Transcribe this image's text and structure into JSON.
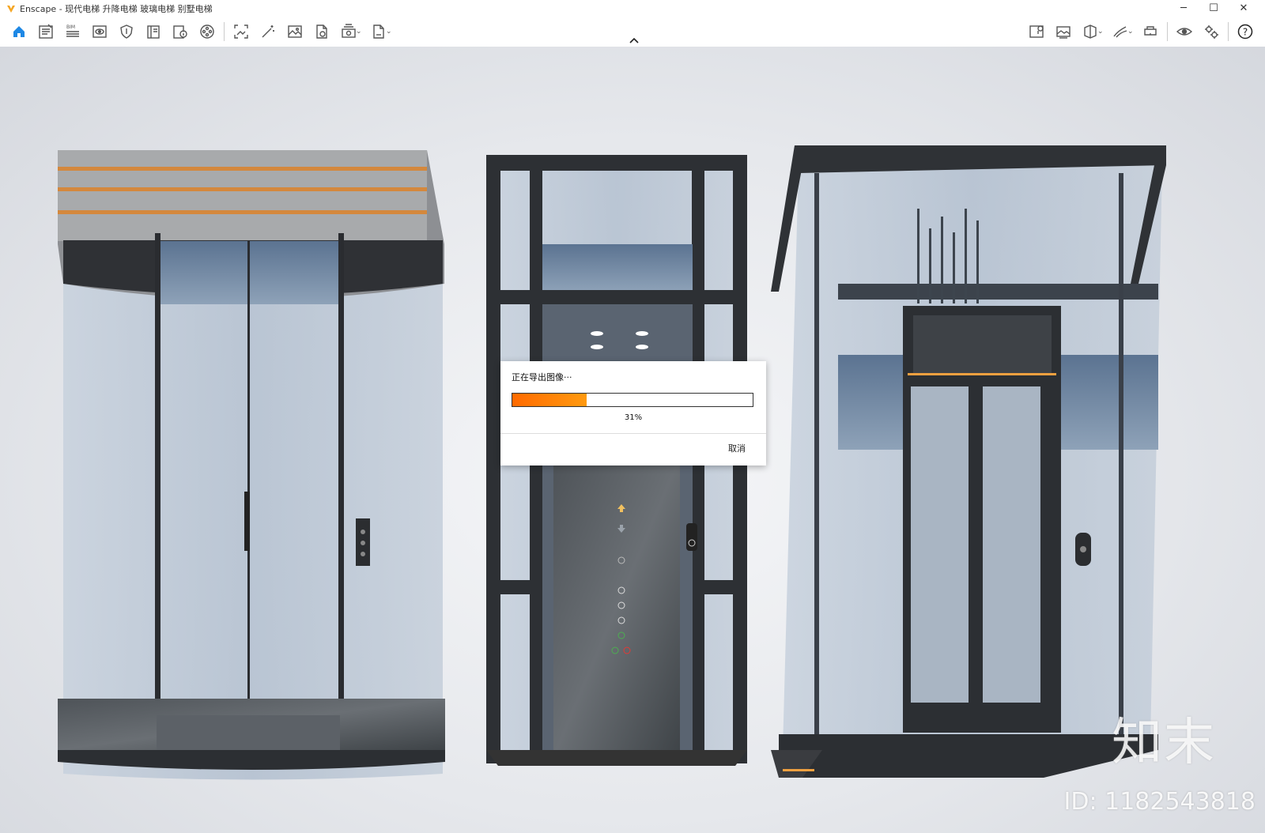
{
  "window": {
    "title": "Enscape - 现代电梯 升降电梯 玻璃电梯 别墅电梯",
    "controls": {
      "minimize": "─",
      "maximize": "☐",
      "close": "✕"
    }
  },
  "toolbar": {
    "left_icons": [
      "home-icon",
      "notes-icon",
      "bim-icon",
      "views-icon",
      "shield-icon",
      "book-icon",
      "info-book-icon",
      "film-reel-icon",
      "screenshot-icon",
      "magic-wand-icon",
      "image-icon",
      "document-icon",
      "batch-render-icon",
      "export-exe-icon"
    ],
    "right_icons": [
      "map-marker-icon",
      "panorama-icon",
      "cube-icon",
      "sketch-icon",
      "vr-headset-icon",
      "visual-settings-icon",
      "settings-icon",
      "help-icon"
    ],
    "bim_label": "BIM",
    "help_label": "?"
  },
  "dialog": {
    "title": "正在导出图像···",
    "progress": 0.31,
    "percent_text": "31%",
    "cancel_label": "取消"
  },
  "viewport": {
    "watermark_logo": "知末",
    "watermark_id": "ID: 1182543818"
  },
  "colors": {
    "accent_blue": "#1e88e5",
    "progress_orange": "#ff7a00",
    "app_logo_orange": "#f5a623"
  }
}
